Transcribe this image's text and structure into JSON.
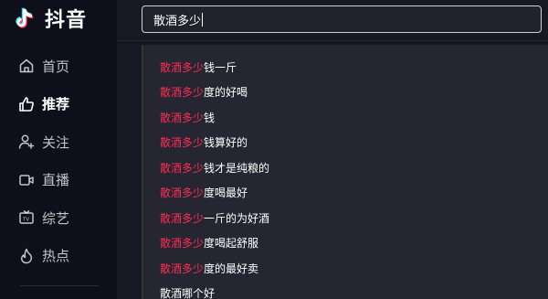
{
  "app": {
    "name": "抖音",
    "logo_icon": "douyin-note-icon",
    "colors": {
      "background": "#161823",
      "sidebar": "#0e0f1a",
      "dropdown": "#252632",
      "highlight": "#fe2c55",
      "logo_cyan": "#25f4ee",
      "logo_red": "#fe2c55"
    }
  },
  "sidebar": {
    "items": [
      {
        "label": "首页",
        "icon": "home-icon",
        "active": false
      },
      {
        "label": "推荐",
        "icon": "thumbs-up-icon",
        "active": true
      },
      {
        "label": "关注",
        "icon": "person-add-icon",
        "active": false
      },
      {
        "label": "直播",
        "icon": "live-camera-icon",
        "active": false
      },
      {
        "label": "综艺",
        "icon": "tv-icon",
        "active": false
      },
      {
        "label": "热点",
        "icon": "flame-icon",
        "active": false
      }
    ]
  },
  "search": {
    "value": "散酒多少"
  },
  "suggestions": [
    {
      "highlight": "散酒多少",
      "rest": "钱一斤"
    },
    {
      "highlight": "散酒多少",
      "rest": "度的好喝"
    },
    {
      "highlight": "散酒多少",
      "rest": "钱"
    },
    {
      "highlight": "散酒多少",
      "rest": "钱算好的"
    },
    {
      "highlight": "散酒多少",
      "rest": "钱才是纯粮的"
    },
    {
      "highlight": "散酒多少",
      "rest": "度喝最好"
    },
    {
      "highlight": "散酒多少",
      "rest": "一斤的为好酒"
    },
    {
      "highlight": "散酒多少",
      "rest": "度喝起舒服"
    },
    {
      "highlight": "散酒多少",
      "rest": "度的最好卖"
    },
    {
      "highlight": "",
      "rest": "散酒哪个好"
    }
  ]
}
